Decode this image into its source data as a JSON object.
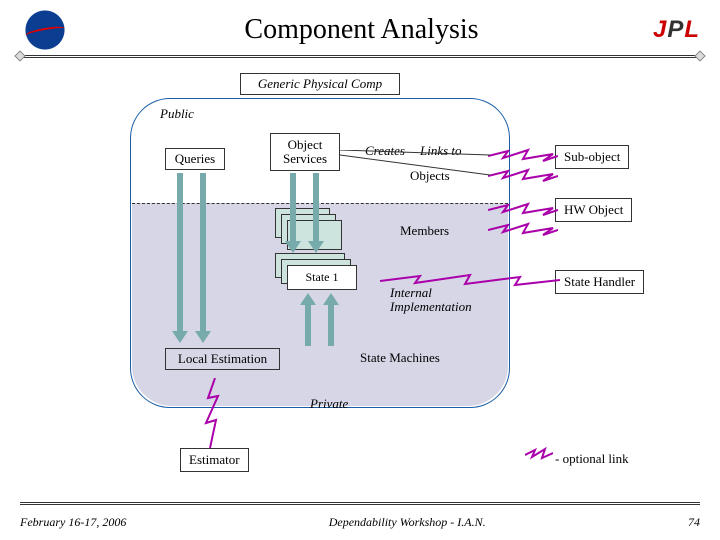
{
  "header": {
    "title": "Component Analysis",
    "logo_left": "NASA",
    "logo_right": "JPL"
  },
  "diagram": {
    "container_label": "Generic Physical Comp",
    "public_label": "Public",
    "private_label": "Private",
    "queries": "Queries",
    "object_services": "Object Services",
    "creates": "Creates",
    "links_to": "Links to",
    "objects": "Objects",
    "members": "Members",
    "state1": "State 1",
    "internal_impl": "Internal\nImplementation",
    "local_estimation": "Local Estimation",
    "state_machines": "State Machines",
    "sub_object": "Sub-object",
    "hw_object": "HW Object",
    "state_handler": "State Handler",
    "estimator": "Estimator",
    "optional_link": "- optional link"
  },
  "footer": {
    "date": "February 16-17, 2006",
    "center": "Dependability Workshop - I.A.N.",
    "page": "74"
  }
}
